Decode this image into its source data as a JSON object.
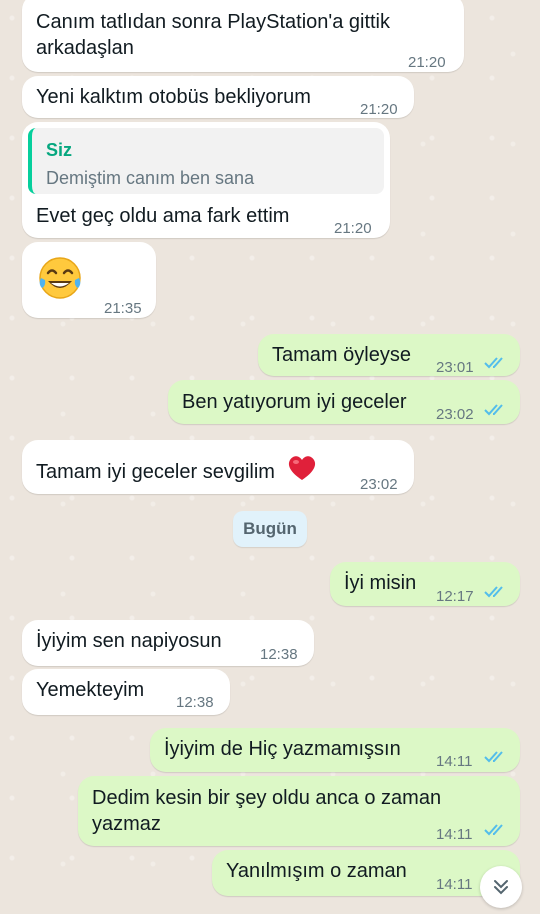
{
  "chat": {
    "date_chip": "Bugün",
    "messages": [
      {
        "id": "m1",
        "dir": "in",
        "text_line1": "Canım tatlıdan sonra PlayStation'a gittik",
        "text_line2": "arkadaşlan",
        "time": "21:20"
      },
      {
        "id": "m2",
        "dir": "in",
        "text": "Yeni kalktım otobüs bekliyorum",
        "time": "21:20"
      },
      {
        "id": "m3",
        "dir": "in",
        "quote_author": "Siz",
        "quote_text": "Demiştim canım ben sana",
        "text": "Evet geç oldu ama fark ettim",
        "time": "21:20"
      },
      {
        "id": "m4",
        "dir": "in",
        "emoji": "face-with-tears-of-joy",
        "time": "21:35"
      },
      {
        "id": "m5",
        "dir": "out",
        "text": "Tamam öyleyse",
        "time": "23:01",
        "status": "read"
      },
      {
        "id": "m6",
        "dir": "out",
        "text": "Ben yatıyorum iyi geceler",
        "time": "23:02",
        "status": "read"
      },
      {
        "id": "m7",
        "dir": "in",
        "text": "Tamam iyi geceler sevgilim",
        "emoji": "red-heart",
        "time": "23:02"
      },
      {
        "id": "m8",
        "dir": "out",
        "text": "İyi misin",
        "time": "12:17",
        "status": "read"
      },
      {
        "id": "m9",
        "dir": "in",
        "text": "İyiyim sen napiyosun",
        "time": "12:38"
      },
      {
        "id": "m10",
        "dir": "in",
        "text": "Yemekteyim",
        "time": "12:38"
      },
      {
        "id": "m11",
        "dir": "out",
        "text": "İyiyim de Hiç yazmamışsın",
        "time": "14:11",
        "status": "read"
      },
      {
        "id": "m12",
        "dir": "out",
        "text_line1": "Dedim kesin bir şey oldu anca o zaman",
        "text_line2": "yazmaz",
        "time": "14:11",
        "status": "read"
      },
      {
        "id": "m13",
        "dir": "out",
        "text": "Yanılmışım o zaman",
        "time": "14:11",
        "status": "read"
      }
    ]
  },
  "colors": {
    "background": "#ECE5DD",
    "incoming": "#FFFFFF",
    "outgoing": "#DCF8C6",
    "read_ticks": "#53BDEB",
    "quote_accent": "#06CF9C"
  },
  "icons": {
    "scroll_down": "chevron-double-down-icon"
  }
}
